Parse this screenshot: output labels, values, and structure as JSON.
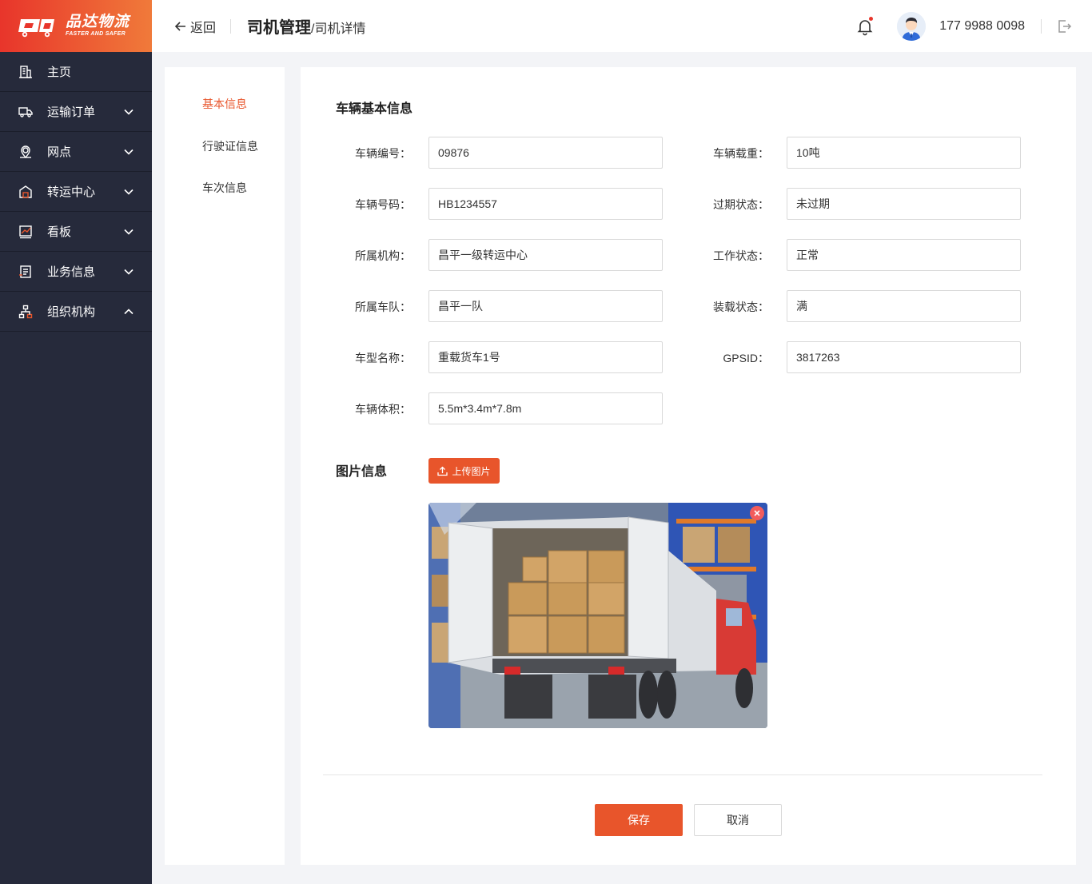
{
  "brand": {
    "name": "品达物流",
    "tagline": "FASTER AND SAFER",
    "gradient_start": "#e8352b",
    "gradient_end": "#f07a3a"
  },
  "sidebar": {
    "items": [
      {
        "label": "主页",
        "icon": "building-icon",
        "expandable": false
      },
      {
        "label": "运输订单",
        "icon": "truck-icon",
        "expandable": true,
        "expanded": false
      },
      {
        "label": "网点",
        "icon": "location-pin-icon",
        "expandable": true,
        "expanded": false
      },
      {
        "label": "转运中心",
        "icon": "warehouse-icon",
        "expandable": true,
        "expanded": false
      },
      {
        "label": "看板",
        "icon": "chart-board-icon",
        "expandable": true,
        "expanded": false
      },
      {
        "label": "业务信息",
        "icon": "document-icon",
        "expandable": true,
        "expanded": false
      },
      {
        "label": "组织机构",
        "icon": "org-chart-icon",
        "expandable": true,
        "expanded": true
      }
    ]
  },
  "header": {
    "back_label": "返回",
    "breadcrumb_main": "司机管理",
    "breadcrumb_separator": "/",
    "breadcrumb_sub": "司机详情",
    "phone": "177 9988 0098",
    "has_notification": true
  },
  "tabs": [
    {
      "label": "基本信息",
      "active": true
    },
    {
      "label": "行驶证信息",
      "active": false
    },
    {
      "label": "车次信息",
      "active": false
    }
  ],
  "vehicle": {
    "section_title": "车辆基本信息",
    "left_fields": [
      {
        "label": "车辆编号：",
        "value": "09876"
      },
      {
        "label": "车辆号码：",
        "value": "HB1234557"
      },
      {
        "label": "所属机构：",
        "value": "昌平一级转运中心"
      },
      {
        "label": "所属车队：",
        "value": "昌平一队"
      },
      {
        "label": "车型名称：",
        "value": "重载货车1号"
      },
      {
        "label": "车辆体积：",
        "value": "5.5m*3.4m*7.8m"
      }
    ],
    "right_fields": [
      {
        "label": "车辆载重：",
        "value": "10吨"
      },
      {
        "label": "过期状态：",
        "value": "未过期"
      },
      {
        "label": "工作状态：",
        "value": "正常"
      },
      {
        "label": "装载状态：",
        "value": "满"
      },
      {
        "label": "GPSID：",
        "value": "3817263"
      }
    ]
  },
  "images": {
    "section_title": "图片信息",
    "upload_label": "上传图片"
  },
  "actions": {
    "save_label": "保存",
    "cancel_label": "取消"
  },
  "colors": {
    "accent": "#e8552b",
    "sidebar_bg": "#262a3b",
    "page_bg": "#f3f4f7"
  }
}
